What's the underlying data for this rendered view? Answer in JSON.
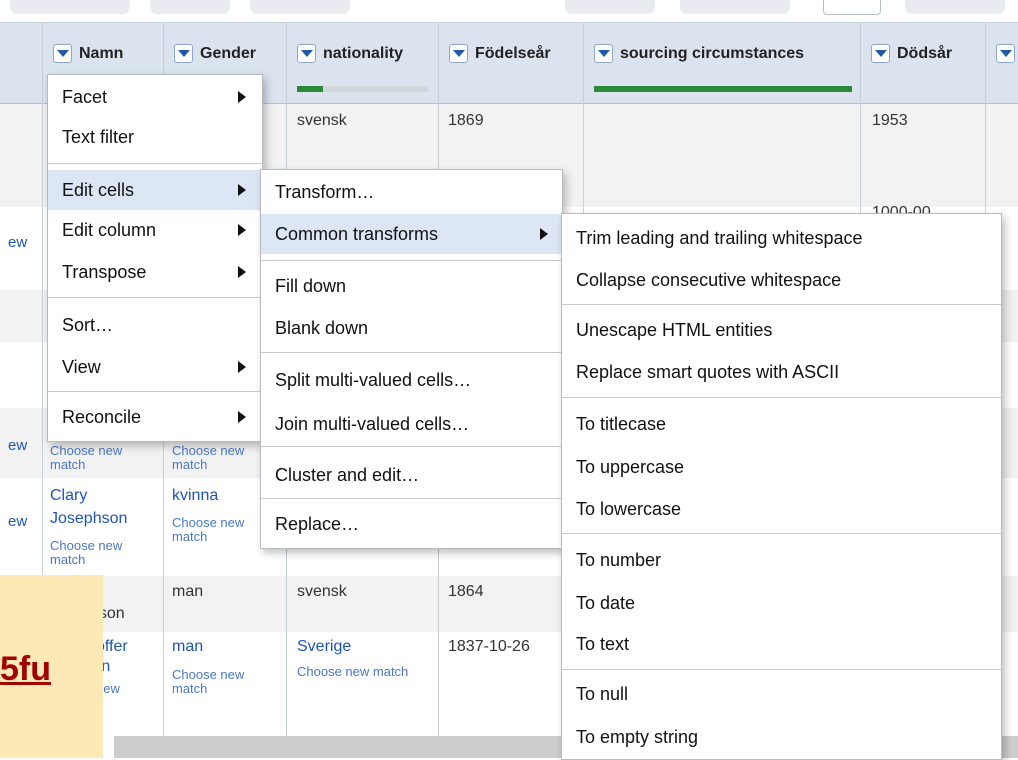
{
  "columns": [
    {
      "name": "Namn",
      "facet_fill": null
    },
    {
      "name": "Gender",
      "facet_fill": null
    },
    {
      "name": "nationality",
      "facet_fill": 0.2
    },
    {
      "name": "Födelseår",
      "facet_fill": null
    },
    {
      "name": "sourcing circumstances",
      "facet_fill": 1.0
    },
    {
      "name": "Dödsår",
      "facet_fill": null
    }
  ],
  "rows": {
    "r1": {
      "nationality": "svensk",
      "birth": "1869",
      "death": "1953"
    },
    "r2": {
      "death_partial": "1000-00"
    },
    "r5": {
      "name_match": "Choose new match",
      "gender_match": "Choose new match"
    },
    "r6": {
      "name_line1": "Clary",
      "name_line2": "Josephson",
      "name_match": "Choose new match",
      "gender": "kvinna",
      "gender_match": "Choose new match"
    },
    "r7": {
      "name_partial": "nson",
      "gender": "man",
      "nationality": "svensk",
      "birth": "1864"
    },
    "r8": {
      "name_line1": "offer",
      "name_line2": "rn",
      "name_match": "new",
      "gender": "man",
      "gender_match": "Choose new match",
      "nationality": "Sverige",
      "nationality_match": "Choose new match",
      "birth": "1837-10-26"
    }
  },
  "left_links": [
    "ew",
    "ew",
    "ew"
  ],
  "menu1": {
    "items": [
      "Facet",
      "Text filter",
      "Edit cells",
      "Edit column",
      "Transpose",
      "Sort…",
      "View",
      "Reconcile"
    ]
  },
  "menu2": {
    "items": [
      "Transform…",
      "Common transforms",
      "Fill down",
      "Blank down",
      "Split multi-valued cells…",
      "Join multi-valued cells…",
      "Cluster and edit…",
      "Replace…"
    ]
  },
  "menu3": {
    "items": [
      "Trim leading and trailing whitespace",
      "Collapse consecutive whitespace",
      "Unescape HTML entities",
      "Replace smart quotes with ASCII",
      "To titlecase",
      "To uppercase",
      "To lowercase",
      "To number",
      "To date",
      "To text",
      "To null",
      "To empty string"
    ]
  },
  "watermark": "5fu",
  "colors": {
    "header_bg": "#dbe3ee",
    "menu_highlight": "#dde6f5",
    "link": "#1e55b5",
    "facet_green": "#2a8a3a"
  }
}
